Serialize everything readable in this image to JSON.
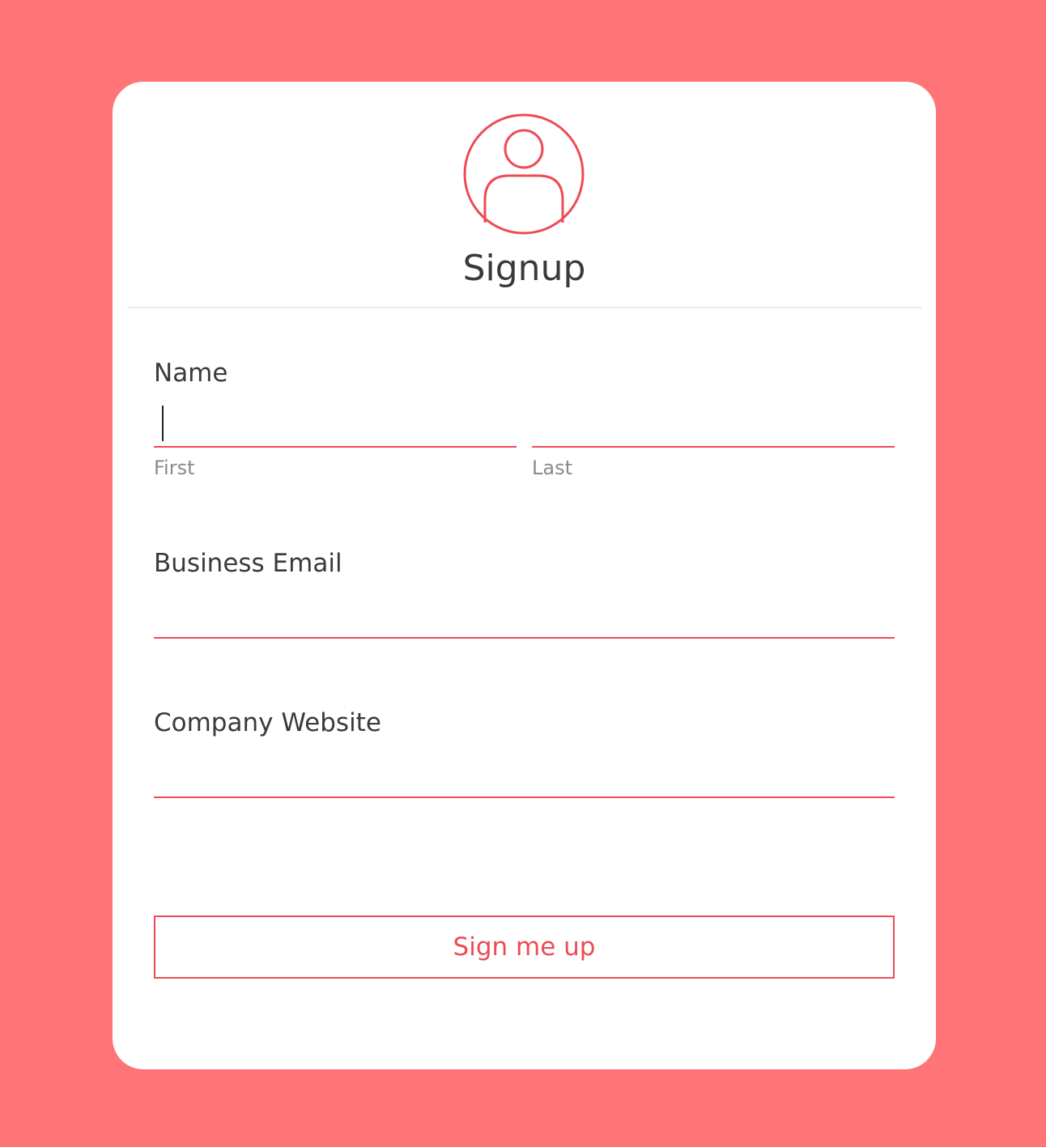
{
  "colors": {
    "background": "#ff7577",
    "accent": "#ee4b55",
    "card": "#ffffff",
    "text": "#3a3a3a",
    "muted": "#8a8a8a"
  },
  "header": {
    "icon": "user-circle-icon",
    "title": "Signup"
  },
  "form": {
    "name": {
      "label": "Name",
      "first": {
        "value": "",
        "sublabel": "First"
      },
      "last": {
        "value": "",
        "sublabel": "Last"
      }
    },
    "email": {
      "label": "Business Email",
      "value": ""
    },
    "website": {
      "label": "Company Website",
      "value": ""
    },
    "submit_label": "Sign me up"
  }
}
